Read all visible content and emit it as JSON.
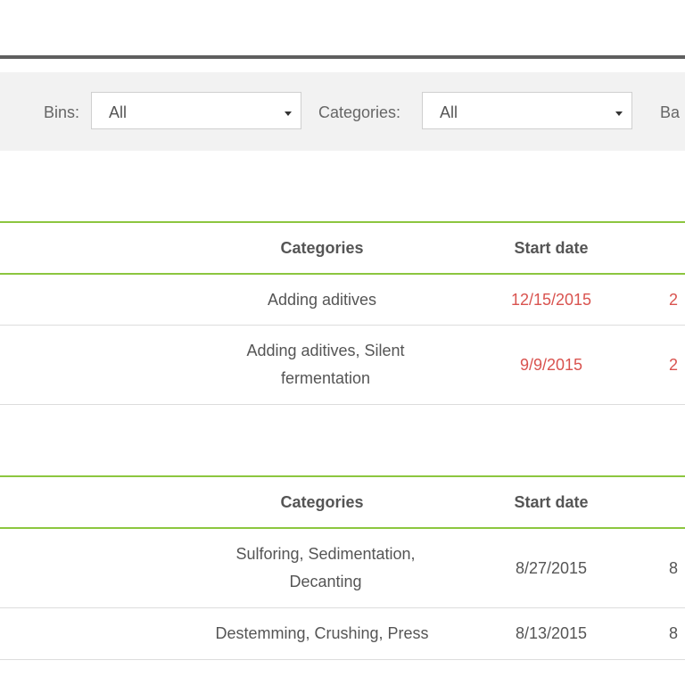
{
  "filters": {
    "bins_label": "Bins:",
    "bins_value": "All",
    "categories_label": "Categories:",
    "categories_value": "All",
    "cut_label": "Ba"
  },
  "tables": [
    {
      "headers": {
        "categories": "Categories",
        "start_date": "Start date"
      },
      "rows": [
        {
          "categories": "Adding aditives",
          "start_date": "12/15/2015",
          "next": "2",
          "overdue": true
        },
        {
          "categories": "Adding aditives, Silent fermentation",
          "start_date": "9/9/2015",
          "next": "2",
          "overdue": true
        }
      ]
    },
    {
      "headers": {
        "categories": "Categories",
        "start_date": "Start date"
      },
      "rows": [
        {
          "categories": "Sulforing, Sedimentation, Decanting",
          "start_date": "8/27/2015",
          "next": "8",
          "overdue": false
        },
        {
          "categories": "Destemming, Crushing, Press",
          "start_date": "8/13/2015",
          "next": "8",
          "overdue": false
        }
      ]
    }
  ],
  "colors": {
    "accent_green": "#8cc63f",
    "overdue_red": "#d9534f"
  }
}
